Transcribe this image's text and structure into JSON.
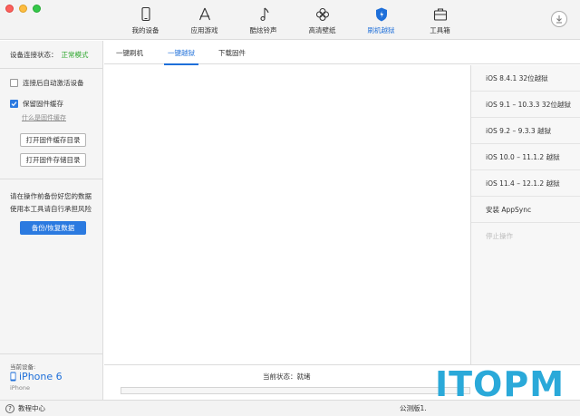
{
  "toolbar": {
    "items": [
      {
        "label": "我的设备",
        "icon": "phone-icon"
      },
      {
        "label": "应用游戏",
        "icon": "app-store-icon"
      },
      {
        "label": "酷炫铃声",
        "icon": "music-note-icon"
      },
      {
        "label": "高清壁纸",
        "icon": "flower-icon"
      },
      {
        "label": "刷机越狱",
        "icon": "shield-icon"
      },
      {
        "label": "工具箱",
        "icon": "toolbox-icon"
      }
    ],
    "active_index": 4,
    "accent_color": "#1e6fd9"
  },
  "sidebar": {
    "device_state_label": "设备连接状态：",
    "device_state_value": "正常模式",
    "auto_activate_label": "连接后自动激活设备",
    "auto_activate_checked": false,
    "keep_firmware_label": "保留固件缓存",
    "keep_firmware_checked": true,
    "what_is_cache_link": "什么是固件缓存",
    "open_cache_dir_button": "打开固件缓存目录",
    "open_storage_dir_button": "打开固件存储目录",
    "warning_line1": "请在操作前备份好您的数据",
    "warning_line2": "使用本工具请自行承担风险",
    "backup_button": "备份/恢复数据",
    "current_device_label": "当前设备:",
    "device_name": "iPhone 6",
    "device_model": "iPhone"
  },
  "tabs": [
    {
      "label": "一键刷机"
    },
    {
      "label": "一键越狱"
    },
    {
      "label": "下载固件"
    }
  ],
  "active_tab": 1,
  "right_panel": {
    "items": [
      {
        "label": "iOS 8.4.1 32位越狱"
      },
      {
        "label": "iOS 9.1 – 10.3.3 32位越狱"
      },
      {
        "label": "iOS 9.2 – 9.3.3 越狱"
      },
      {
        "label": "iOS 10.0 – 11.1.2 越狱"
      },
      {
        "label": "iOS 11.4 – 12.1.2 越狱"
      },
      {
        "label": "安装 AppSync"
      },
      {
        "label": "停止操作"
      }
    ],
    "disabled_index": 6
  },
  "status": {
    "label": "当前状态：就绪",
    "progress": 0
  },
  "bottombar": {
    "help_label": "教程中心",
    "version_label": "公测版1."
  },
  "watermark": {
    "text": "ITOPM"
  }
}
